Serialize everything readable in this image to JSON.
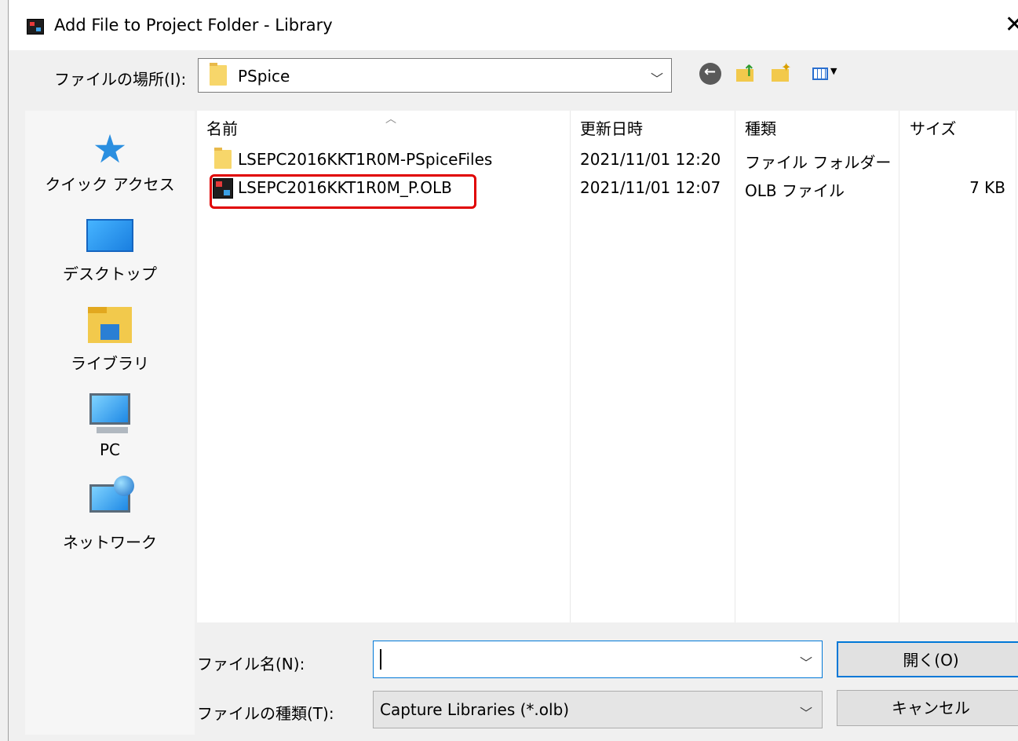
{
  "window": {
    "title": "Add File to Project Folder - Library",
    "close_glyph": "✕"
  },
  "lookin": {
    "label": "ファイルの場所(I):",
    "value": "PSpice"
  },
  "toolbar": {
    "back_icon": "back-arrow-icon",
    "up_icon": "up-folder-icon",
    "new_folder_icon": "new-folder-icon",
    "view_icon": "view-menu-icon"
  },
  "places": [
    {
      "label": "クイック アクセス",
      "icon": "quick-access-star-icon"
    },
    {
      "label": "デスクトップ",
      "icon": "desktop-icon"
    },
    {
      "label": "ライブラリ",
      "icon": "library-icon"
    },
    {
      "label": "PC",
      "icon": "pc-icon"
    },
    {
      "label": "ネットワーク",
      "icon": "network-icon"
    }
  ],
  "columns": {
    "name": "名前",
    "modified": "更新日時",
    "type": "種類",
    "size": "サイズ"
  },
  "files": [
    {
      "name": "LSEPC2016KKT1R0M-PSpiceFiles",
      "modified": "2021/11/01 12:20",
      "type": "ファイル フォルダー",
      "size": "",
      "icon": "folder-icon"
    },
    {
      "name": "LSEPC2016KKT1R0M_P.OLB",
      "modified": "2021/11/01 12:07",
      "type": "OLB ファイル",
      "size": "7 KB",
      "icon": "olb-file-icon",
      "highlighted": true
    }
  ],
  "filename": {
    "label": "ファイル名(N):",
    "value": ""
  },
  "filetype": {
    "label": "ファイルの種類(T):",
    "value": "Capture Libraries (*.olb)"
  },
  "buttons": {
    "open": "開く(O)",
    "cancel": "キャンセル"
  },
  "colors": {
    "highlight": "#e00000",
    "accent": "#0078d7"
  }
}
